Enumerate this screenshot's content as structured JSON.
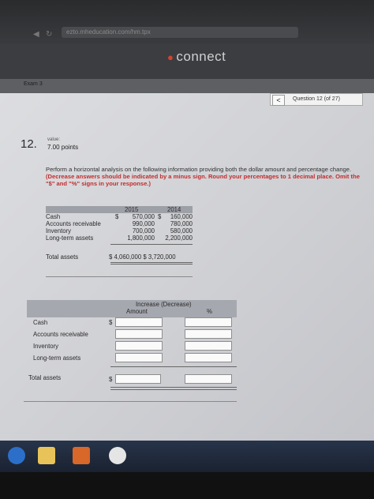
{
  "browser": {
    "url": "ezto.mheducation.com/hm.tpx",
    "back_icon": "arrow-left-icon",
    "refresh_icon": "refresh-icon"
  },
  "header": {
    "brand": "connect",
    "brand_sub": "",
    "brand_color": "#d6432d"
  },
  "exam": {
    "label": "Exam 3"
  },
  "navigation": {
    "prev": "<",
    "counter": "Question 12 (of 27)"
  },
  "question": {
    "number": "12.",
    "value_label": "value:",
    "points": "7.00 points",
    "instructions_plain": "Perform a horizontal analysis on the following information providing both the dollar amount and percentage change.",
    "instructions_red": "(Decrease answers should be indicated by a minus sign. Round your percentages to 1 decimal place. Omit the \"$\" and \"%\" signs in your response.)"
  },
  "given_table": {
    "years": [
      "2015",
      "2014"
    ],
    "rows": [
      {
        "label": "Cash",
        "d1": "$",
        "v2015": "570,000",
        "d2": "$",
        "v2014": "160,000"
      },
      {
        "label": "Accounts receivable",
        "v2015": "990,000",
        "v2014": "780,000"
      },
      {
        "label": "Inventory",
        "v2015": "700,000",
        "v2014": "580,000"
      },
      {
        "label": "Long-term assets",
        "v2015": "1,800,000",
        "v2014": "2,200,000"
      }
    ],
    "total": {
      "label": "Total assets",
      "value": "$ 4,060,000 $ 3,720,000"
    }
  },
  "answer_table": {
    "header": "Increase (Decrease)",
    "col_amount": "Amount",
    "col_pct": "%",
    "rows": [
      "Cash",
      "Accounts receivable",
      "Inventory",
      "Long-term assets"
    ],
    "total_label": "Total assets",
    "dollar": "$"
  }
}
